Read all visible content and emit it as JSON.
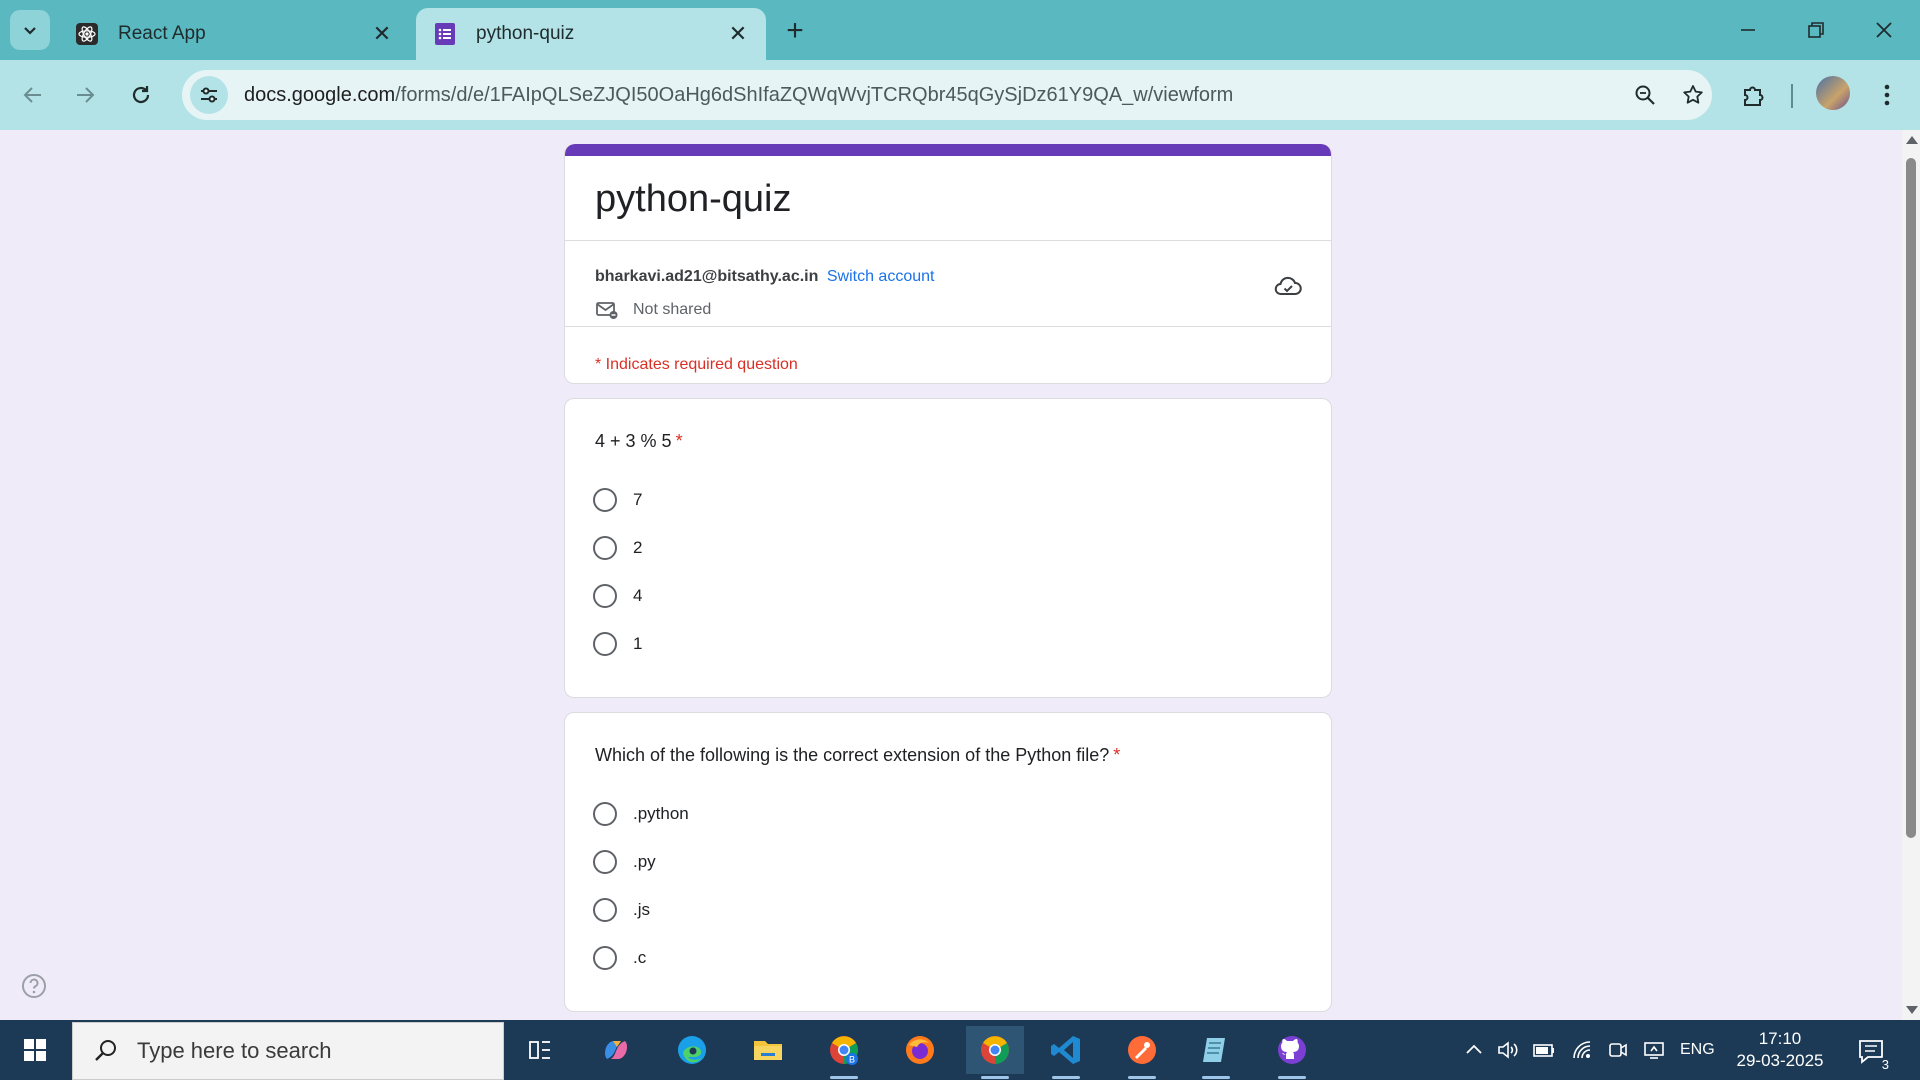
{
  "browser": {
    "tabs": [
      {
        "title": "React App",
        "active": false,
        "icon": "react-icon"
      },
      {
        "title": "python-quiz",
        "active": true,
        "icon": "google-forms-icon"
      }
    ],
    "url_domain": "docs.google.com",
    "url_path": "/forms/d/e/1FAIpQLSeZJQI50OaHg6dShIfaZQWqWvjTCRQbr45qGySjDz61Y9QA_w/viewform",
    "colors": {
      "tabstrip": "#5ab8c0",
      "toolbar": "#b3e3e6"
    }
  },
  "form": {
    "title": "python-quiz",
    "email": "bharkavi.ad21@bitsathy.ac.in",
    "switch_account": "Switch account",
    "not_shared": "Not shared",
    "required_note": "* Indicates required question",
    "accent_color": "#673ab7",
    "questions": [
      {
        "text": "4 + 3 % 5",
        "required_mark": "*",
        "options": [
          "7",
          "2",
          "4",
          "1"
        ]
      },
      {
        "text": "Which of the following is the correct extension of the Python file?",
        "required_mark": "*",
        "options": [
          ".python",
          ".py",
          ".js",
          ".c"
        ]
      }
    ]
  },
  "taskbar": {
    "search_placeholder": "Type here to search",
    "apps": [
      "task-view-icon",
      "copilot-icon",
      "edge-icon",
      "file-explorer-icon",
      "chrome-profile-icon",
      "firefox-icon",
      "chrome-icon",
      "vscode-icon",
      "postman-icon",
      "notepad-icon",
      "github-icon"
    ],
    "language": "ENG",
    "time": "17:10",
    "date": "29-03-2025",
    "notification_count": "3"
  }
}
